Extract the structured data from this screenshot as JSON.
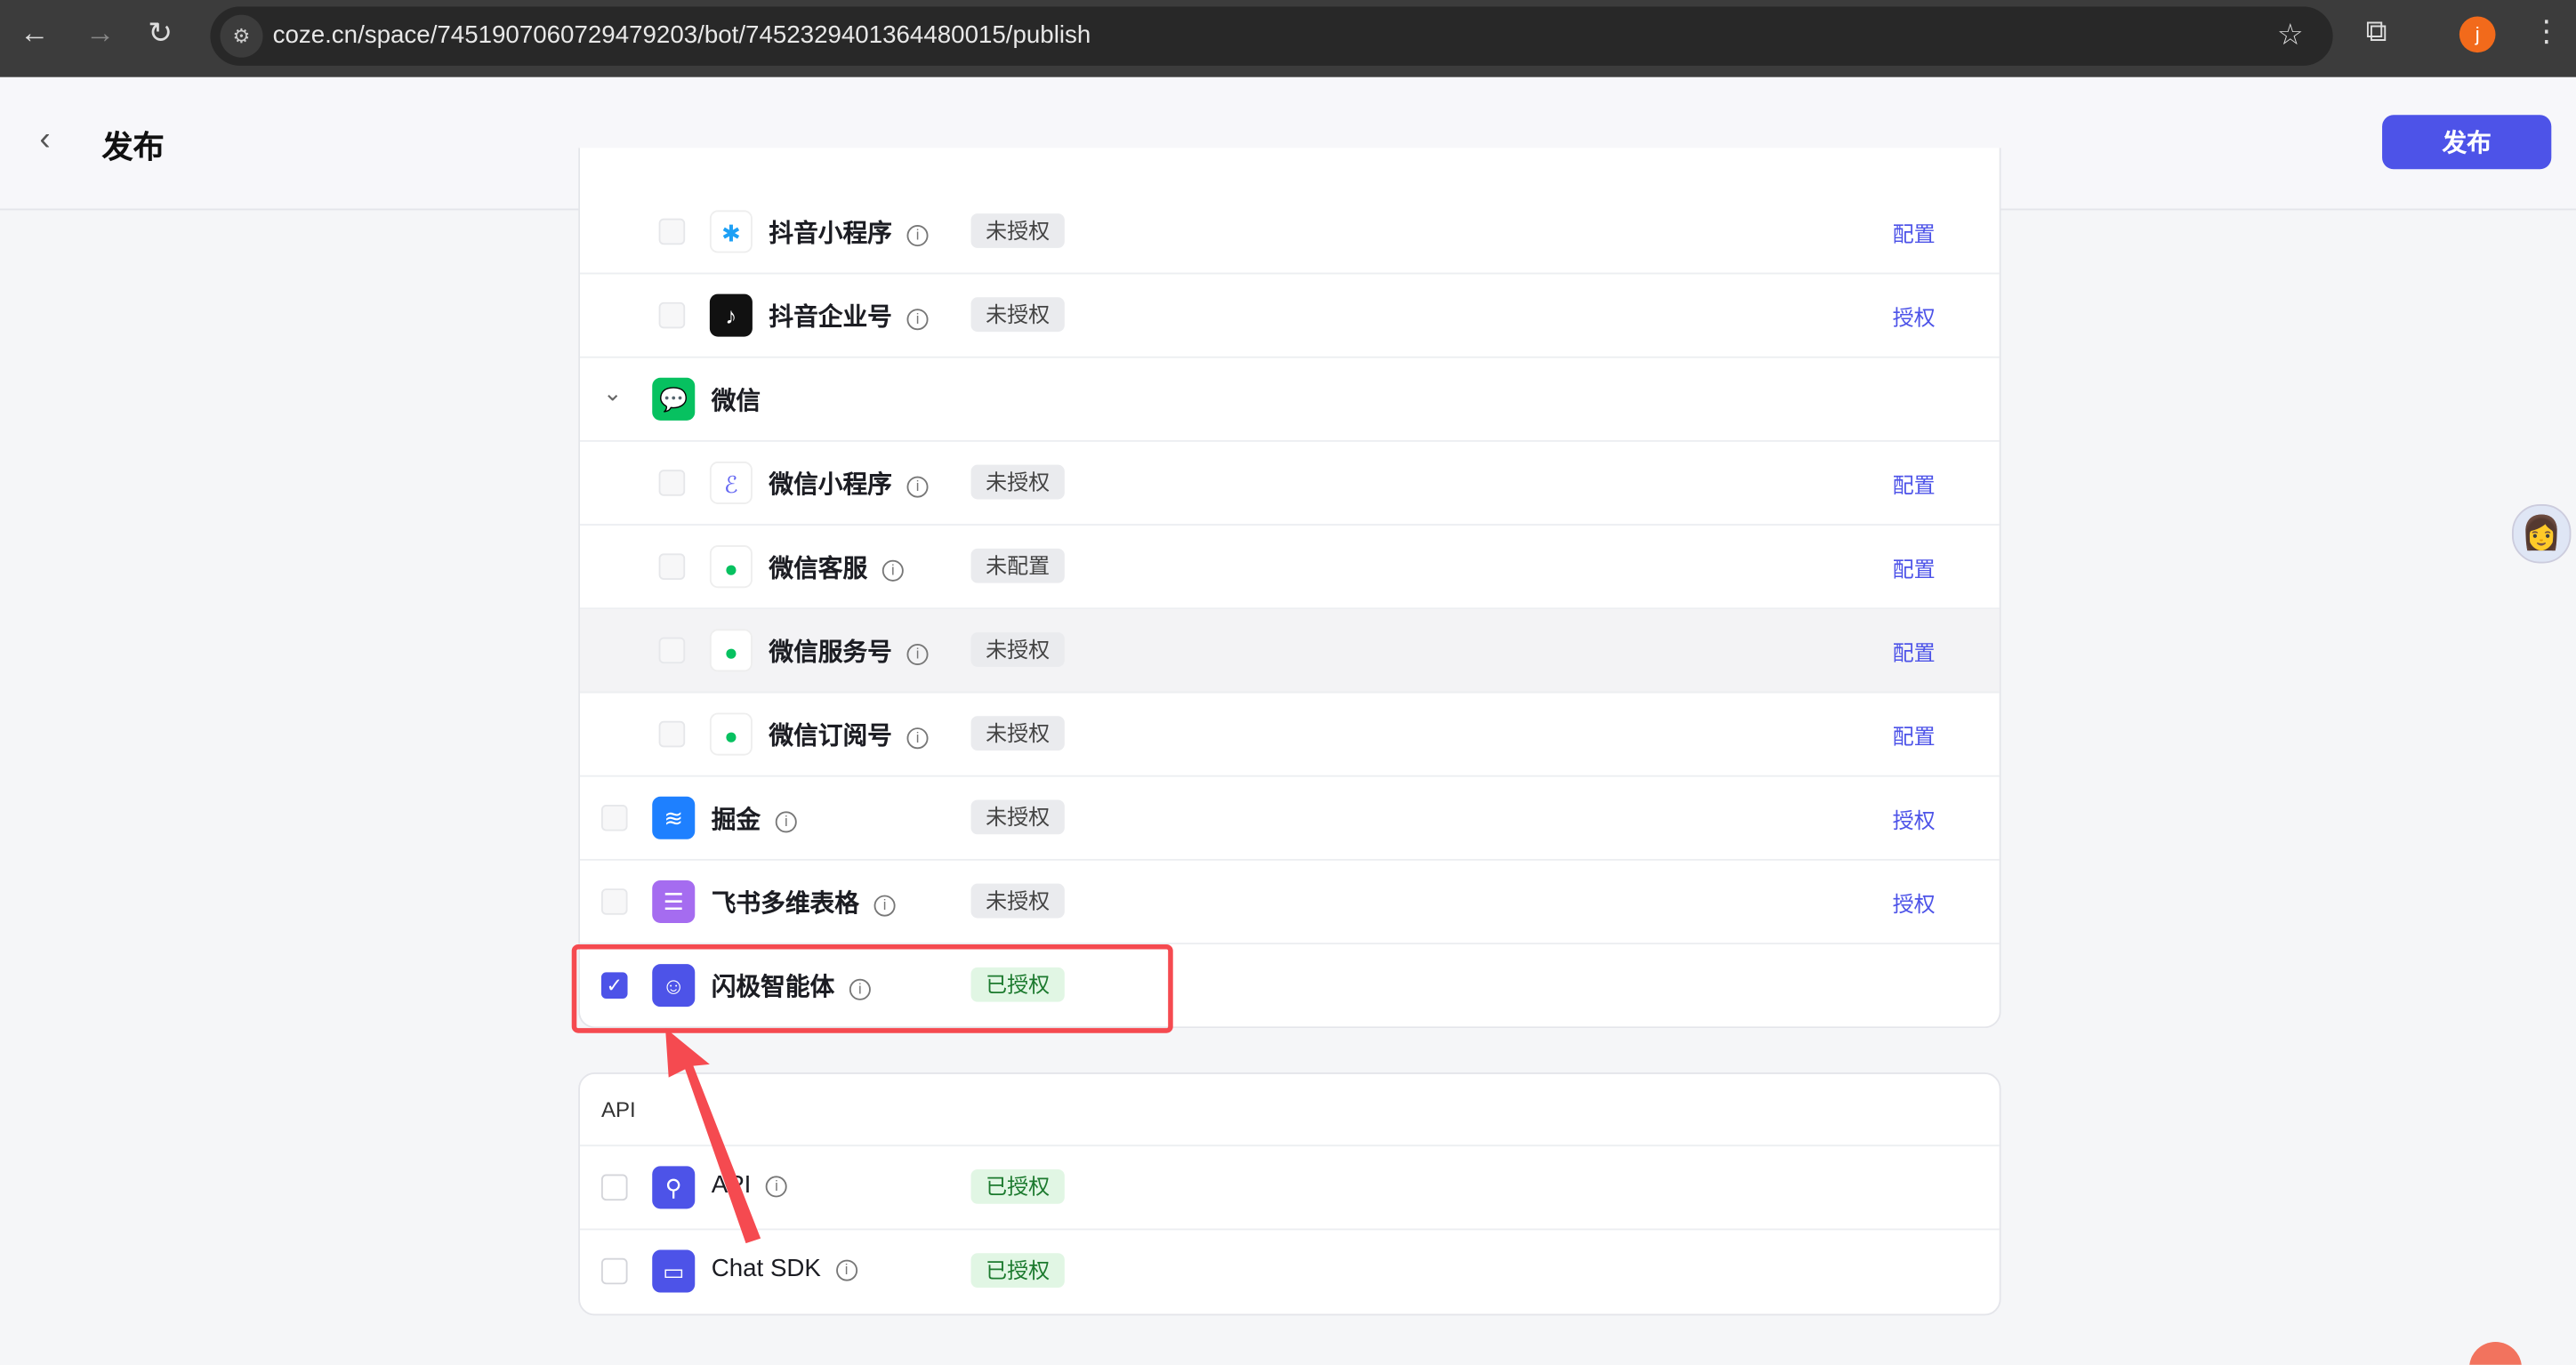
{
  "browser": {
    "url": "coze.cn/space/7451907060729479203/bot/7452329401364480015/publish",
    "avatar_letter": "j"
  },
  "header": {
    "title": "发布",
    "publish_label": "发布"
  },
  "channels": [
    {
      "name": "抖音小程序",
      "status": "未授权",
      "action": "配置",
      "level": "child",
      "icon": "douyin-miniapp-icon",
      "color": "#1ea0f5"
    },
    {
      "name": "抖音企业号",
      "status": "未授权",
      "action": "授权",
      "level": "child",
      "icon": "douyin-icon",
      "color": "#111111"
    },
    {
      "name": "微信",
      "level": "group",
      "icon": "wechat-icon",
      "color": "#07c160"
    },
    {
      "name": "微信小程序",
      "status": "未授权",
      "action": "配置",
      "level": "child",
      "icon": "wechat-miniapp-icon",
      "color": "#6467f2"
    },
    {
      "name": "微信客服",
      "status": "未配置",
      "action": "配置",
      "level": "child",
      "icon": "wechat-service-icon",
      "color": "#07c160"
    },
    {
      "name": "微信服务号",
      "status": "未授权",
      "action": "配置",
      "level": "child",
      "icon": "wechat-official-icon",
      "color": "#07c160"
    },
    {
      "name": "微信订阅号",
      "status": "未授权",
      "action": "配置",
      "level": "child",
      "icon": "wechat-subscription-icon",
      "color": "#07c160"
    },
    {
      "name": "掘金",
      "status": "未授权",
      "action": "授权",
      "level": "top",
      "icon": "juejin-icon",
      "color": "#1e80ff"
    },
    {
      "name": "飞书多维表格",
      "status": "未授权",
      "action": "授权",
      "level": "top",
      "icon": "feishu-bitable-icon",
      "color": "#a56cf0"
    },
    {
      "name": "闪极智能体",
      "status": "已授权",
      "level": "top",
      "icon": "shanji-agent-icon",
      "color": "#4d53e8",
      "checked": true
    }
  ],
  "api_section": {
    "title": "API",
    "items": [
      {
        "name": "API",
        "status": "已授权",
        "icon": "api-plug-icon"
      },
      {
        "name": "Chat SDK",
        "status": "已授权",
        "icon": "chat-sdk-icon"
      }
    ]
  },
  "colors": {
    "accent": "#4d53e8",
    "highlight": "#f54a50",
    "authorized": "#1c7a2e"
  }
}
